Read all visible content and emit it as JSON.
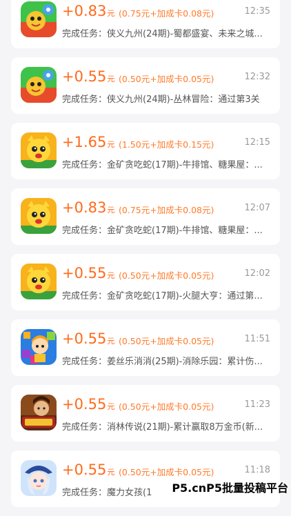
{
  "records": [
    {
      "amount": "+0.83",
      "unit": "元",
      "detail": "(0.75元+加成卡0.08元)",
      "time": "12:35",
      "desc": "完成任务：侠义九州(24期)-蜀都盛宴、未来之城...",
      "icon": "xiayi-game-icon"
    },
    {
      "amount": "+0.55",
      "unit": "元",
      "detail": "(0.50元+加成卡0.05元)",
      "time": "12:32",
      "desc": "完成任务：侠义九州(24期)-丛林冒险：通过第3关",
      "icon": "xiayi-game-icon"
    },
    {
      "amount": "+1.65",
      "unit": "元",
      "detail": "(1.50元+加成卡0.15元)",
      "time": "12:15",
      "desc": "完成任务：金矿贪吃蛇(17期)-牛排馆、糖果屋：...",
      "icon": "snake-game-icon"
    },
    {
      "amount": "+0.83",
      "unit": "元",
      "detail": "(0.75元+加成卡0.08元)",
      "time": "12:07",
      "desc": "完成任务：金矿贪吃蛇(17期)-牛排馆、糖果屋：...",
      "icon": "snake-game-icon"
    },
    {
      "amount": "+0.55",
      "unit": "元",
      "detail": "(0.50元+加成卡0.05元)",
      "time": "12:02",
      "desc": "完成任务：金矿贪吃蛇(17期)-火腿大亨：通过第...",
      "icon": "snake-game-icon"
    },
    {
      "amount": "+0.55",
      "unit": "元",
      "detail": "(0.50元+加成卡0.05元)",
      "time": "11:51",
      "desc": "完成任务：姜丝乐消消(25期)-消除乐园：累计伤...",
      "icon": "match-game-icon"
    },
    {
      "amount": "+0.55",
      "unit": "元",
      "detail": "(0.50元+加成卡0.05元)",
      "time": "11:23",
      "desc": "完成任务：消林传说(21期)-累计赢取8万金币(新...",
      "icon": "legend-game-icon"
    },
    {
      "amount": "+0.55",
      "unit": "元",
      "detail": "(0.50元+加成卡0.05元)",
      "time": "11:18",
      "desc": "完成任务：魔力女孩(1",
      "icon": "magic-girl-game-icon"
    }
  ],
  "watermark": "P5.cnP5批量投稿平台"
}
